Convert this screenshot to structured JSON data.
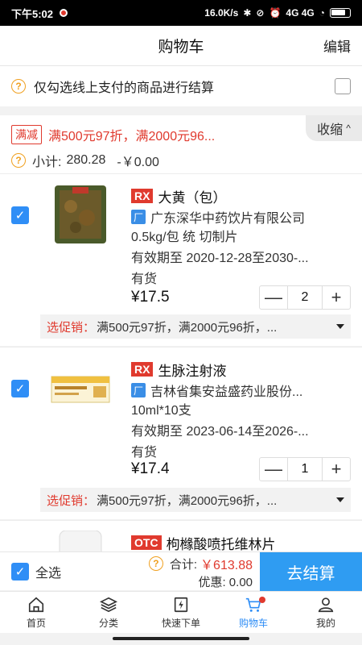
{
  "status": {
    "time": "下午5:02",
    "speed": "16.0K/s",
    "signal": "4G 4G"
  },
  "header": {
    "title": "购物车",
    "edit": "编辑"
  },
  "notice": {
    "text": "仅勾选线上支付的商品进行结算",
    "checked": false
  },
  "promo": {
    "tag": "满减",
    "text": "满500元97折，满2000元96...",
    "collapse": "收缩",
    "subtotal_label": "小计:",
    "subtotal_value": "280.28",
    "discount": "-￥0.00"
  },
  "items": [
    {
      "type": "RX",
      "name": "大黄（包）",
      "factory_badge": "厂",
      "maker": "广东深华中药饮片有限公司",
      "spec": "0.5kg/包 统 切制片",
      "validity": "有效期至  2020-12-28至2030-...",
      "stock": "有货",
      "price": "¥17.5",
      "qty": "2",
      "promo_label": "选促销：",
      "promo_value": "满500元97折，满2000元96折，..."
    },
    {
      "type": "RX",
      "name": "生脉注射液",
      "factory_badge": "厂",
      "maker": "吉林省集安益盛药业股份...",
      "spec": "10ml*10支",
      "validity": "有效期至  2023-06-14至2026-...",
      "stock": "有货",
      "price": "¥17.4",
      "qty": "1",
      "promo_label": "选促销：",
      "promo_value": "满500元97折，满2000元96折，..."
    },
    {
      "type": "OTC",
      "name": "枸橼酸喷托维林片"
    }
  ],
  "footer": {
    "select_all": "全选",
    "total_label": "合计:",
    "total_value": "￥613.88",
    "discount": "优惠: 0.00",
    "checkout": "去结算"
  },
  "tabs": [
    {
      "label": "首页",
      "icon": "home-icon"
    },
    {
      "label": "分类",
      "icon": "layers-icon"
    },
    {
      "label": "快速下单",
      "icon": "quick-order-icon"
    },
    {
      "label": "购物车",
      "icon": "cart-icon",
      "active": true
    },
    {
      "label": "我的",
      "icon": "user-icon"
    }
  ],
  "colors": {
    "accent": "#2f8ef6",
    "price_red": "#e03a2e",
    "checkout": "#2f9cf2"
  }
}
